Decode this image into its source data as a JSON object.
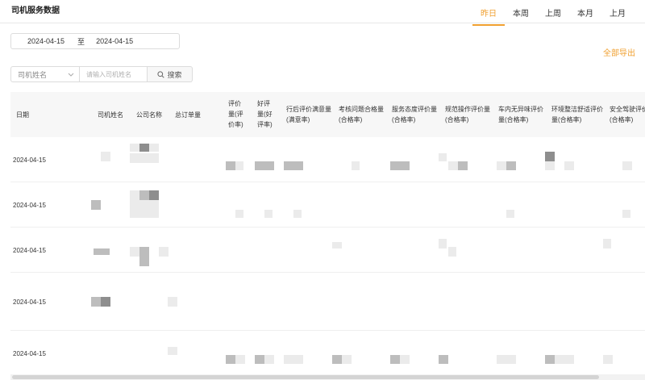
{
  "page": {
    "title": "司机服务数据"
  },
  "tabs": [
    "昨日",
    "本周",
    "上周",
    "本月",
    "上月"
  ],
  "active_tab": "昨日",
  "date_range": {
    "start": "2024-04-15",
    "separator": "至",
    "end": "2024-04-15"
  },
  "export": {
    "label": "全部导出"
  },
  "filter": {
    "select_label": "司机姓名",
    "input_placeholder": "请输入司机姓名",
    "search_label": "搜索"
  },
  "table": {
    "columns": [
      "日期",
      "司机姓名",
      "公司名称",
      "总订单量",
      "评价量(评价率)",
      "好评量(好评率)",
      "行后评价满意量(满意率)",
      "考核问题合格量(合格率)",
      "服务态度评价量(合格率)",
      "规范操作评价量(合格率)",
      "车内无异味评价量(合格率)",
      "环境整洁舒适评价量(合格率)",
      "安全驾驶评价量(合格率)"
    ],
    "rows": [
      {
        "date": "2024-04-15"
      },
      {
        "date": "2024-04-15"
      },
      {
        "date": "2024-04-15"
      },
      {
        "date": "2024-04-15"
      },
      {
        "date": "2024-04-15"
      }
    ]
  },
  "colors": {
    "accent": "#f0a030",
    "header_bg": "#f7f7f7",
    "border": "#dcdcdc"
  }
}
